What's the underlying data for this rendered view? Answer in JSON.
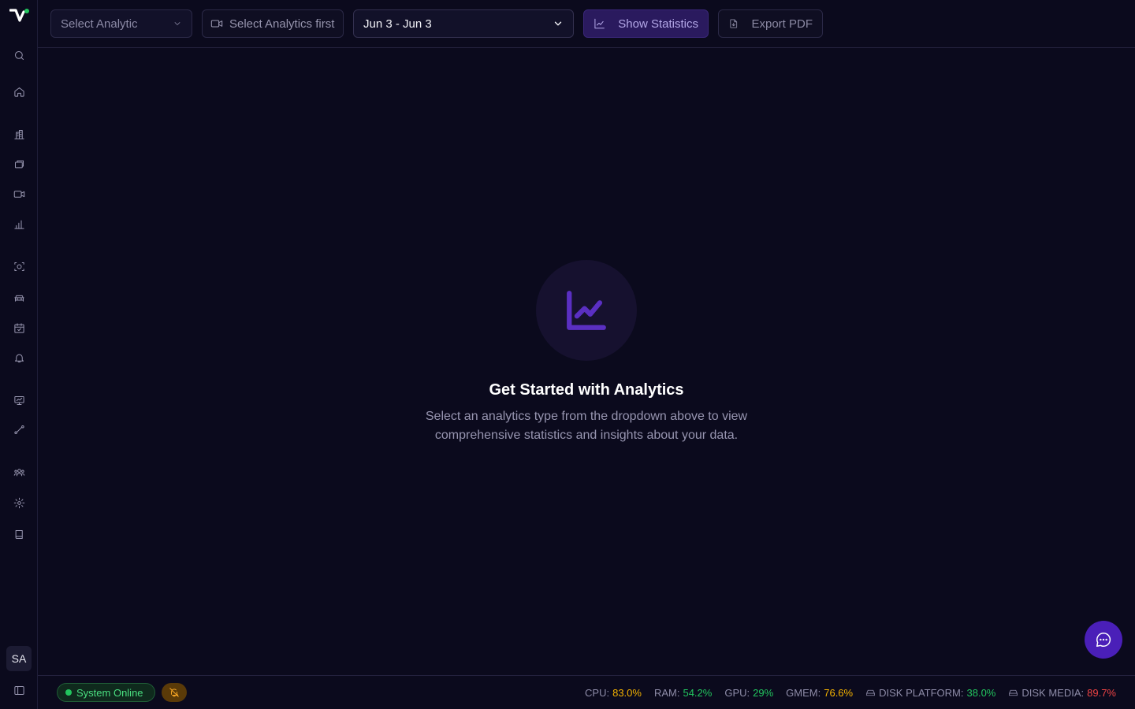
{
  "toolbar": {
    "analytic_select_placeholder": "Select Analytic",
    "camera_select_placeholder": "Select Analytics first",
    "date_range": "Jun 3 - Jun 3",
    "show_statistics_label": "Show Statistics",
    "export_pdf_label": "Export PDF"
  },
  "empty_state": {
    "title": "Get Started with Analytics",
    "description": "Select an analytics type from the dropdown above to view comprehensive statistics and insights about your data."
  },
  "user": {
    "initials": "SA"
  },
  "footer": {
    "status_text": "System Online",
    "metrics": [
      {
        "label": "CPU:",
        "value": "83.0%",
        "color": "#f5b301"
      },
      {
        "label": "RAM:",
        "value": "54.2%",
        "color": "#22c55e"
      },
      {
        "label": "GPU:",
        "value": "29%",
        "color": "#22c55e"
      },
      {
        "label": "GMEM:",
        "value": "76.6%",
        "color": "#f5b301"
      },
      {
        "label": "DISK PLATFORM:",
        "value": "38.0%",
        "color": "#22c55e"
      },
      {
        "label": "DISK MEDIA:",
        "value": "89.7%",
        "color": "#ef4444"
      }
    ]
  },
  "colors": {
    "background": "#0b0a1d",
    "accent": "#4a1fb8",
    "status_online": "#22c55e"
  }
}
